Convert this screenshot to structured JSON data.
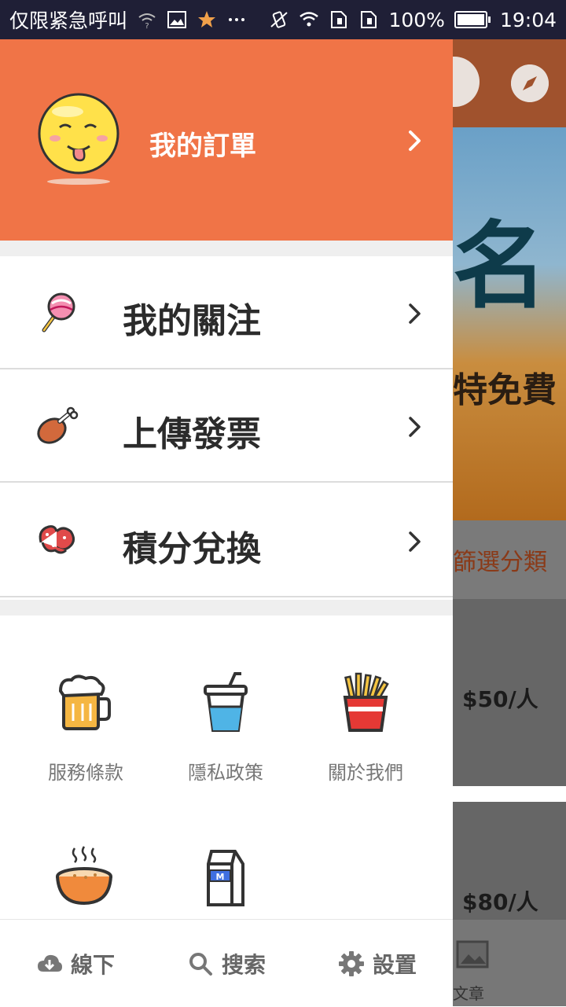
{
  "status_bar": {
    "carrier_text": "仅限紧急呼叫",
    "battery": "100%",
    "time": "19:04",
    "icons": [
      "wifi-question-icon",
      "image-icon",
      "star-icon",
      "more-icon",
      "vibrate-icon",
      "wifi-icon",
      "sim-icon",
      "sim-icon",
      "battery-icon"
    ]
  },
  "drawer": {
    "header": {
      "title": "我的訂單",
      "background": "#f07447",
      "avatar_icon": "smiley-avatar-icon"
    },
    "menu": [
      {
        "label": "我的關注",
        "icon": "lollipop-icon"
      },
      {
        "label": "上傳發票",
        "icon": "drumstick-icon"
      },
      {
        "label": "積分兌換",
        "icon": "octopus-icon"
      }
    ],
    "grid": [
      {
        "label": "服務條款",
        "icon": "beer-icon"
      },
      {
        "label": "隱私政策",
        "icon": "drink-cup-icon"
      },
      {
        "label": "關於我們",
        "icon": "fries-icon"
      },
      {
        "label": "",
        "icon": "soup-bowl-icon"
      },
      {
        "label": "",
        "icon": "milk-carton-icon",
        "icon_text": "M"
      }
    ],
    "bottom_bar": [
      {
        "label": "線下",
        "icon": "cloud-download-icon"
      },
      {
        "label": "搜索",
        "icon": "search-icon"
      },
      {
        "label": "設置",
        "icon": "gear-icon"
      }
    ]
  },
  "background_app": {
    "banner_big_text": "名",
    "banner_small_text": "特免費",
    "filter_label": "篩選分類",
    "prices": [
      "$50/人",
      "$80/人"
    ],
    "tab_label": "文章"
  }
}
